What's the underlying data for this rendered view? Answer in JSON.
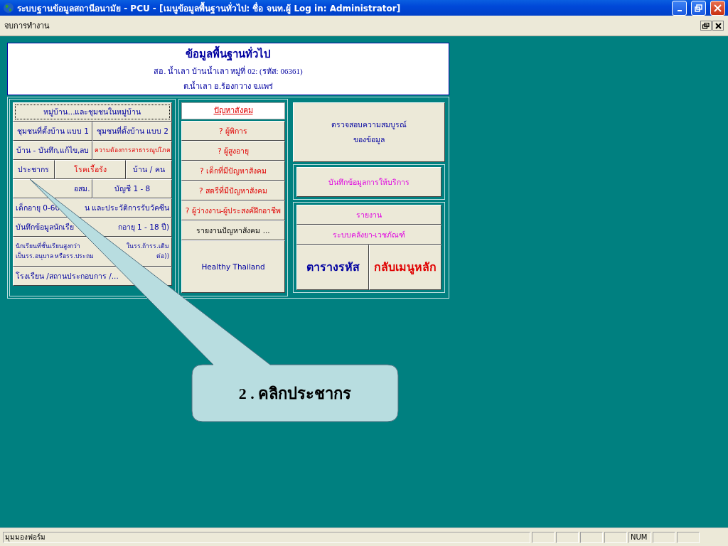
{
  "window": {
    "title": "ระบบฐานข้อมูลสถานีอนามัย - PCU - [เมนูข้อมูลพื้นฐานทั่วไป: ชื่อ จนท.ผู้ Log in: Administrator]"
  },
  "menu_bar": {
    "items": [
      "จบการทำงาน"
    ]
  },
  "header": {
    "title": "ข้อมูลพื้นฐานทั่วไป",
    "line_1": "สอ. น้ำเลา บ้านน้ำเลา หมู่ที่ 02: (รหัส: 06361)",
    "line_2": "ต.น้ำเลา อ.ร้องกวาง  จ.แพร่"
  },
  "left_buttons": [
    [
      {
        "lines": [
          "หมู่บ้าน...และชุมชนในหมู่บ้าน"
        ],
        "kind": "plain",
        "focused": true
      }
    ],
    [
      {
        "lines": [
          "ชุมชนที่ตั้งบ้าน แบบ 1"
        ],
        "kind": "plain",
        "focused": false
      },
      {
        "lines": [
          "ชุมชนที่ตั้งบ้าน แบบ 2"
        ],
        "kind": "plain",
        "focused": false
      }
    ],
    [
      {
        "lines": [
          "บ้าน - บันทึก,แก้ไข,ลบ"
        ],
        "kind": "plain",
        "focused": false
      },
      {
        "lines": [
          "ความต้องการสาธารณูปโภค"
        ],
        "kind": "notice",
        "focused": false
      }
    ],
    [
      {
        "lines": [
          "ประชากร"
        ],
        "kind": "plain",
        "focused": false
      },
      {
        "lines": [
          "โรคเรื้อรัง"
        ],
        "kind": "alert",
        "focused": false
      },
      {
        "lines": [
          "บ้าน / คน"
        ],
        "kind": "plain",
        "focused": false
      }
    ],
    [
      {
        "lines": [
          "อสม."
        ],
        "kind": "plain",
        "focused": false
      },
      {
        "lines": [
          "บัญชี 1 - 8"
        ],
        "kind": "plain",
        "focused": false
      }
    ],
    [
      {
        "lines": [
          [
            "เด็กอายุ 0-60",
            "น และประวัติการรับวัคซีน"
          ]
        ],
        "kind": "plain",
        "focused": false
      }
    ],
    [
      {
        "lines": [
          [
            "บันทึกข้อมูลนักเรีย",
            "กอายุ 1 - 18 ปี)"
          ]
        ],
        "kind": "plain",
        "focused": false
      }
    ],
    [
      {
        "lines": [
          [
            "นักเรียนที่ชั้นเรียนสูงกว่า",
            "ในรร.ถ้ารร.เดิม"
          ],
          [
            "เป็นรร.อนุบาล หรือรร.ประถม",
            "ต่อ))"
          ]
        ],
        "kind": "plain",
        "focused": false
      }
    ],
    [
      {
        "lines": [
          "โรงเรียน /สถานประกอบการ /..."
        ],
        "kind": "plain",
        "focused": false
      }
    ]
  ],
  "social": {
    "title": "ปัญหาสังคม",
    "buttons": [
      {
        "label": "? ผู้พิการ",
        "kind": "alert"
      },
      {
        "label": "? ผู้สูงอายุ",
        "kind": "alert"
      },
      {
        "label": "? เด็กที่มีปัญหาสังคม",
        "kind": "alert"
      },
      {
        "label": "? สตรีที่มีปัญหาสังคม",
        "kind": "alert"
      },
      {
        "label": "? ผู้ว่างงาน-ผู้ประสงค์ฝึกอาชีพ",
        "kind": "alert"
      },
      {
        "label": "รายงานปัญหาสังคม ...",
        "kind": "report"
      },
      {
        "label": "Healthy Thailand",
        "kind": "plain"
      }
    ]
  },
  "right": {
    "check_button": {
      "lines": [
        "ตรวจสอบความสมบูรณ์",
        "ของข้อมูล"
      ]
    },
    "service_button": "บันทึกข้อมูลการให้บริการ",
    "report_buttons": [
      "รายงาน",
      "ระบบคลังยา-เวชภัณฑ์"
    ],
    "bottom_buttons": [
      {
        "label": "ตารางรหัส",
        "kind": "plain"
      },
      {
        "label": "กลับเมนูหลัก",
        "kind": "alert"
      }
    ]
  },
  "callout": {
    "text": "2 . คลิกประชากร"
  },
  "status_bar": {
    "text": "มุมมองฟอร์ม",
    "num_indicator": "NUM"
  }
}
